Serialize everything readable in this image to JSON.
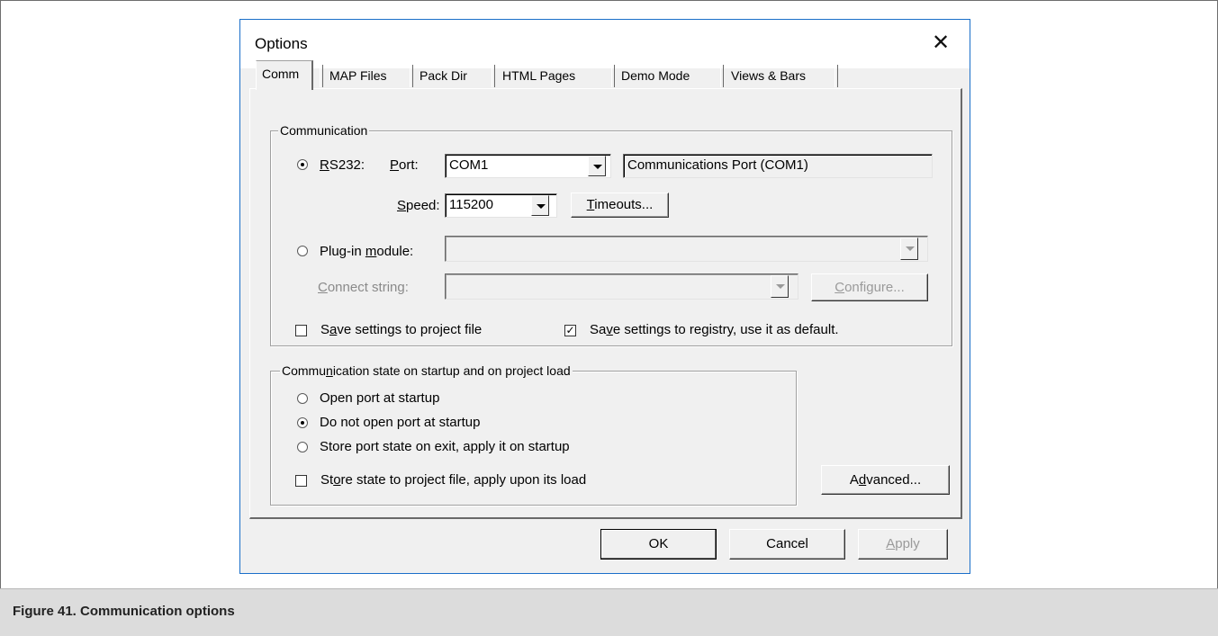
{
  "dialog": {
    "title": "Options",
    "close_glyph": "✕"
  },
  "tabs": [
    {
      "label": "Comm",
      "active": true
    },
    {
      "label": "MAP Files"
    },
    {
      "label": "Pack Dir"
    },
    {
      "label": "HTML Pages"
    },
    {
      "label": "Demo Mode"
    },
    {
      "label": "Views & Bars"
    }
  ],
  "communication": {
    "legend": "Communication",
    "rs232": {
      "radio_label_pre": "",
      "radio_label_u": "R",
      "radio_label_post": "S232:",
      "selected": true
    },
    "port_label_u": "P",
    "port_label_post": "ort:",
    "port_value": "COM1",
    "port_description": "Communications Port (COM1)",
    "speed_label_u": "S",
    "speed_label_post": "peed:",
    "speed_value": "115200",
    "timeouts_u": "T",
    "timeouts_post": "imeouts...",
    "plugin": {
      "label_pre": "Plug-in ",
      "label_u": "m",
      "label_post": "odule:",
      "selected": false,
      "value": ""
    },
    "connect_u": "C",
    "connect_post": "onnect string:",
    "connect_value": "",
    "configure_u": "C",
    "configure_post": "onfigure...",
    "save_project": {
      "pre": "S",
      "u": "a",
      "post": "ve settings to project file",
      "checked": false
    },
    "save_registry": {
      "pre": "Sa",
      "u": "v",
      "post": "e settings to registry, use it as default.",
      "checked": true
    }
  },
  "startup": {
    "legend_pre": "Commu",
    "legend_u": "n",
    "legend_post": "ication state on startup and on project load",
    "options": [
      {
        "label": "Open port at startup",
        "selected": false
      },
      {
        "label": "Do not open port at startup",
        "selected": true
      },
      {
        "label": "Store port state on exit, apply it on startup",
        "selected": false
      }
    ],
    "store_state": {
      "pre": "St",
      "u": "o",
      "post": "re state to project file, apply upon its load",
      "checked": false
    }
  },
  "advanced_pre": "A",
  "advanced_u": "d",
  "advanced_post": "vanced...",
  "footer": {
    "ok": "OK",
    "cancel": "Cancel",
    "apply_u": "A",
    "apply_post": "pply"
  },
  "caption": "Figure 41. Communication options"
}
